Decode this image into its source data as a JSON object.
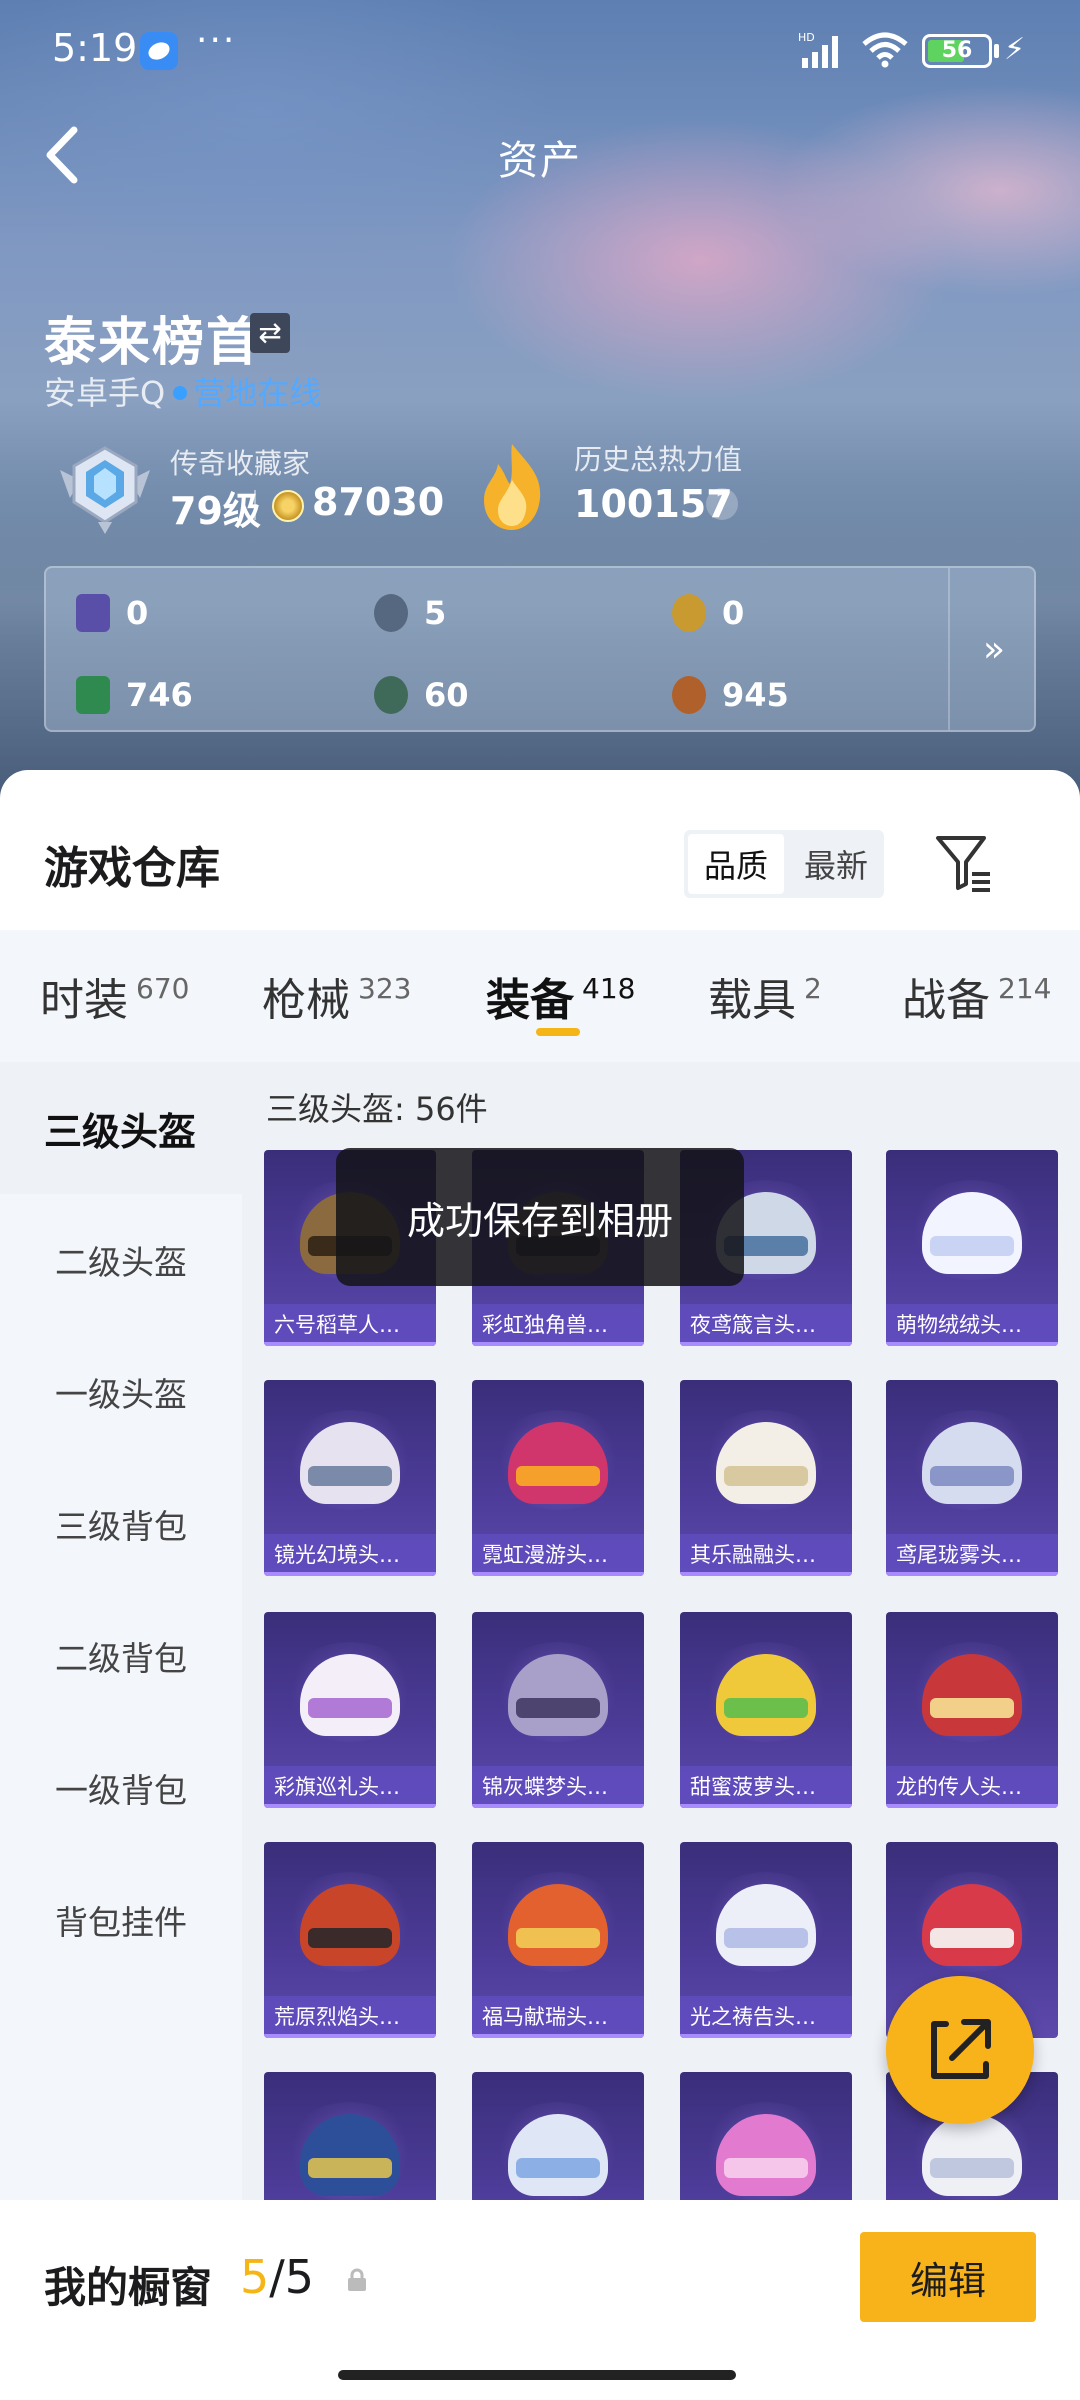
{
  "status": {
    "time": "5:19",
    "more": "···",
    "battery": "56"
  },
  "header": {
    "title": "资产"
  },
  "profile": {
    "name": "泰来榜首",
    "platform": "安卓手Q",
    "online": "营地在线",
    "rank_title": "传奇收藏家",
    "level": "79级",
    "coins": "87030",
    "heat_title": "历史总热力值",
    "heat_value": "100157",
    "help": "?"
  },
  "currencies": [
    {
      "value": "0",
      "color": "#5a4fa8"
    },
    {
      "value": "5",
      "color": "#56687f"
    },
    {
      "value": "0",
      "color": "#c89a2f"
    },
    {
      "value": "746",
      "color": "#2f8a4f"
    },
    {
      "value": "60",
      "color": "#3f6a5a"
    },
    {
      "value": "945",
      "color": "#b0602b"
    }
  ],
  "currency_more": "»",
  "warehouse": {
    "title": "游戏仓库",
    "sort": [
      "品质",
      "最新"
    ]
  },
  "tabs": [
    {
      "label": "时装",
      "count": "670"
    },
    {
      "label": "枪械",
      "count": "323"
    },
    {
      "label": "装备",
      "count": "418"
    },
    {
      "label": "载具",
      "count": "2"
    },
    {
      "label": "战备",
      "count": "214"
    }
  ],
  "categories": [
    "三级头盔",
    "二级头盔",
    "一级头盔",
    "三级背包",
    "二级背包",
    "一级背包",
    "背包挂件"
  ],
  "item_count": "三级头盔: 56件",
  "items": [
    {
      "name": "六号稻草人…",
      "helmet": "#8a6a3e",
      "visor": "#3a2a1a"
    },
    {
      "name": "彩虹独角兽…",
      "helmet": "#6a5a4e",
      "visor": "#2a2a2a"
    },
    {
      "name": "夜鸢箴言头…",
      "helmet": "#cfd8e6",
      "visor": "#5a7fa8"
    },
    {
      "name": "萌物绒绒头…",
      "helmet": "#f2f4ff",
      "visor": "#c9d4f5"
    },
    {
      "name": "镜光幻境头…",
      "helmet": "#e6e2f0",
      "visor": "#7a8aa8"
    },
    {
      "name": "霓虹漫游头…",
      "helmet": "#d0356b",
      "visor": "#f5a02a"
    },
    {
      "name": "其乐融融头…",
      "helmet": "#f4efe6",
      "visor": "#d8c9a0"
    },
    {
      "name": "鸢尾珑雾头…",
      "helmet": "#d6dcf0",
      "visor": "#8a96c8"
    },
    {
      "name": "彩旗巡礼头…",
      "helmet": "#f3eef8",
      "visor": "#b07ad6"
    },
    {
      "name": "锦灰蝶梦头…",
      "helmet": "#a8a0c8",
      "visor": "#4d4470"
    },
    {
      "name": "甜蜜菠萝头…",
      "helmet": "#f0c93a",
      "visor": "#6bbf4a"
    },
    {
      "name": "龙的传人头…",
      "helmet": "#c8373a",
      "visor": "#f2d08a"
    },
    {
      "name": "荒原烈焰头…",
      "helmet": "#c8452a",
      "visor": "#3a2a2a"
    },
    {
      "name": "福马献瑞头…",
      "helmet": "#e2612e",
      "visor": "#f0c050"
    },
    {
      "name": "光之祷告头…",
      "helmet": "#eceef8",
      "visor": "#b8c2e8"
    },
    {
      "name": "",
      "helmet": "#d83a4a",
      "visor": "#f5e6e6"
    },
    {
      "name": "",
      "helmet": "#2d4f9a",
      "visor": "#c9b45a"
    },
    {
      "name": "",
      "helmet": "#dfe6f5",
      "visor": "#8cb0e6"
    },
    {
      "name": "",
      "helmet": "#e27ad0",
      "visor": "#f5c6ea"
    },
    {
      "name": "",
      "helmet": "#eef0f6",
      "visor": "#c0c8e0"
    }
  ],
  "toast": "成功保存到相册",
  "showcase": {
    "title": "我的橱窗",
    "current": "5",
    "total": "/5",
    "edit": "编辑"
  }
}
